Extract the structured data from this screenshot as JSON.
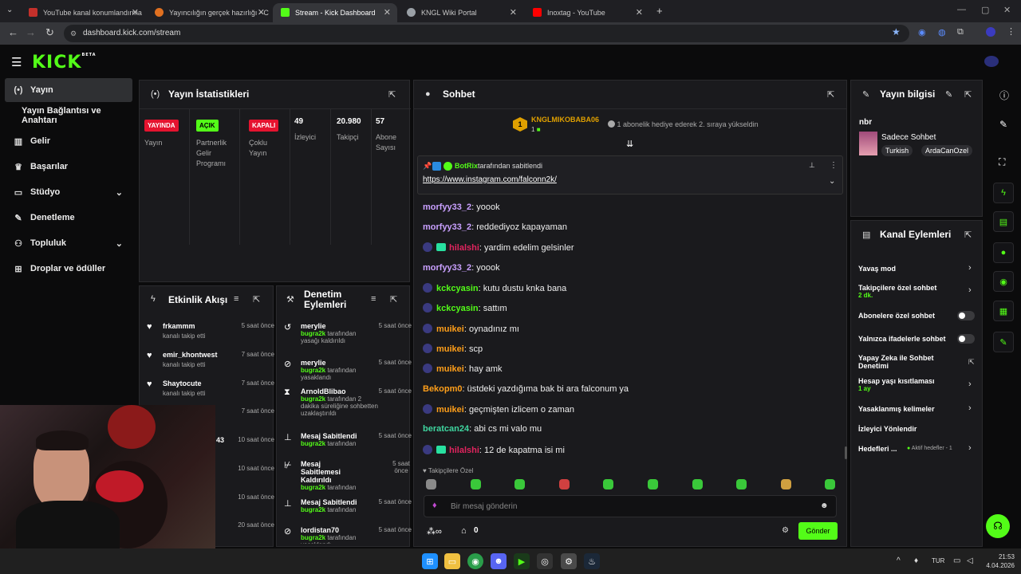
{
  "browser": {
    "tabs": [
      {
        "title": "YouTube kanal konumlandırma",
        "fav": "#c4302b"
      },
      {
        "title": "Yayıncılığın gerçek hazırlığı - C",
        "fav": "#e07020"
      },
      {
        "title": "Stream - Kick Dashboard",
        "fav": "#53fc18"
      },
      {
        "title": "KNGL Wiki Portal",
        "fav": "#9aa0a6"
      },
      {
        "title": "Inoxtag - YouTube",
        "fav": "#ff0000"
      }
    ],
    "url": "dashboard.kick.com/stream"
  },
  "brand": {
    "logo": "KICK",
    "beta": "BETA",
    "accent": "#53fc18"
  },
  "sidebar": {
    "items": [
      {
        "label": "Yayın",
        "icon": "broadcast-icon"
      },
      {
        "label": "Yayın Bağlantısı ve Anahtarı",
        "icon": ""
      },
      {
        "label": "Gelir",
        "icon": "chart-icon"
      },
      {
        "label": "Başarılar",
        "icon": "trophy-icon"
      },
      {
        "label": "Stüdyo",
        "icon": "studio-icon"
      },
      {
        "label": "Denetleme",
        "icon": "wrench-icon"
      },
      {
        "label": "Topluluk",
        "icon": "users-icon"
      },
      {
        "label": "Droplar ve ödüller",
        "icon": "gift-icon"
      }
    ]
  },
  "stats": {
    "title": "Yayın İstatistikleri",
    "cols": [
      {
        "badge": "YAYINDA",
        "label": "Yayın"
      },
      {
        "badge": "AÇIK",
        "label": "Partnerlik Gelir Programı"
      },
      {
        "badge": "KAPALI",
        "label": "Çoklu Yayın"
      },
      {
        "value": "49",
        "label": "İzleyici"
      },
      {
        "value": "20.980",
        "label": "Takipçi"
      },
      {
        "value": "57",
        "label": "Abone Sayısı"
      }
    ]
  },
  "activity": {
    "title": "Etkinlik Akışı",
    "items": [
      {
        "user": "frkammm",
        "text": "kanalı takip etti",
        "time": "5 saat önce"
      },
      {
        "user": "emir_khontwest",
        "text": "kanalı takip etti",
        "time": "7 saat önce"
      },
      {
        "user": "Shaytocute",
        "text": "kanalı takip etti",
        "time": "7 saat önce"
      },
      {
        "user": "a",
        "text": "",
        "time": "7 saat önce"
      },
      {
        "user": "43",
        "text": "",
        "time": "10 saat önce"
      },
      {
        "user": "",
        "text": "",
        "time": "10 saat önce"
      },
      {
        "user": "",
        "text": "",
        "time": "10 saat önce"
      },
      {
        "user": "",
        "text": "",
        "time": "20 saat önce"
      }
    ]
  },
  "moderation": {
    "title": "Denetim Eylemleri",
    "items": [
      {
        "user": "merylie",
        "by": "bugra2k",
        "text": "tarafından yasağı kaldırıldı",
        "time": "5 saat önce",
        "icon": "undo-icon"
      },
      {
        "user": "merylie",
        "by": "bugra2k",
        "text": "tarafından yasaklandı",
        "time": "5 saat önce",
        "icon": "ban-icon"
      },
      {
        "user": "ArnoldBlibao",
        "by": "bugra2k",
        "text": "tarafından 2 dakika süreliğine sohbetten uzaklaştırıldı",
        "time": "5 saat önce",
        "icon": "hourglass-icon"
      },
      {
        "user": "Mesaj Sabitlendi",
        "by": "bugra2k",
        "text": "tarafından",
        "time": "5 saat önce",
        "icon": "pin-icon"
      },
      {
        "user": "Mesaj Sabitlemesi Kaldırıldı",
        "by": "bugra2k",
        "text": "tarafından",
        "time": "5 saat önce",
        "icon": "unpin-icon"
      },
      {
        "user": "Mesaj Sabitlendi",
        "by": "bugra2k",
        "text": "tarafından",
        "time": "5 saat önce",
        "icon": "pin-icon"
      },
      {
        "user": "lordistan70",
        "by": "bugra2k",
        "text": "tarafından yasaklandı",
        "time": "5 saat önce",
        "icon": "ban-icon"
      }
    ]
  },
  "chat": {
    "title": "Sohbet",
    "gift_user": "KNGLMIKOBABA06",
    "gift_count": "1",
    "gift_rank": "1",
    "gift_text": "1 abonelik hediye ederek 2. sıraya yükseldin",
    "pinned_by": "BotRix",
    "pinned_suffix": "tarafından sabitlendi",
    "pinned_link": "https://www.instagram.com/falconn2k/",
    "messages": [
      {
        "user": "morfyy33_2",
        "color": "#c9a0ff",
        "text": ": yoook",
        "av": false,
        "gift": false
      },
      {
        "user": "morfyy33_2",
        "color": "#c9a0ff",
        "text": ": reddediyoz kapayaman",
        "av": false,
        "gift": false
      },
      {
        "user": "hilalshi",
        "color": "#e0245e",
        "text": ": yardim edelim gelsinler",
        "av": true,
        "gift": true
      },
      {
        "user": "morfyy33_2",
        "color": "#c9a0ff",
        "text": ": yoook",
        "av": false,
        "gift": false
      },
      {
        "user": "kckcyasin",
        "color": "#53fc18",
        "text": ": kutu dustu knka bana",
        "av": true,
        "gift": false
      },
      {
        "user": "kckcyasin",
        "color": "#53fc18",
        "text": ": sattım",
        "av": true,
        "gift": false
      },
      {
        "user": "muikei",
        "color": "#ff9f1a",
        "text": ": oynadınız mı",
        "av": true,
        "gift": false
      },
      {
        "user": "muikei",
        "color": "#ff9f1a",
        "text": ": scp",
        "av": true,
        "gift": false
      },
      {
        "user": "muikei",
        "color": "#ff9f1a",
        "text": ": hay amk",
        "av": true,
        "gift": false
      },
      {
        "user": "Bekopm0",
        "color": "#ff9f1a",
        "text": ": üstdeki yazdığıma bak bi ara falconum ya",
        "av": false,
        "gift": false
      },
      {
        "user": "muikei",
        "color": "#ff9f1a",
        "text": ": geçmişten izlicem o zaman",
        "av": true,
        "gift": false
      },
      {
        "user": "beratcan24",
        "color": "#3fd6a0",
        "text": ": abi cs mi valo mu",
        "av": false,
        "gift": false
      },
      {
        "user": "hilalshi",
        "color": "#e0245e",
        "text": ": 12 de kapatma isi mi",
        "av": true,
        "gift": true
      }
    ],
    "follower_only": "Takipçilere Özel",
    "input_placeholder": "Bir mesaj gönderin",
    "points": "0",
    "send": "Gönder"
  },
  "info": {
    "title": "Yayın bilgisi",
    "stream_title": "nbr",
    "category": "Sadece Sohbet",
    "tags": [
      "Turkish",
      "ArdaCanOzel"
    ]
  },
  "channel_actions": {
    "title": "Kanal Eylemleri",
    "items": [
      {
        "label": "Yavaş mod",
        "sub": "",
        "control": "chevron"
      },
      {
        "label": "Takipçilere özel sohbet",
        "sub": "2 dk.",
        "control": "chevron"
      },
      {
        "label": "Abonelere özel sohbet",
        "sub": "",
        "control": "toggle"
      },
      {
        "label": "Yalnızca ifadelerle sohbet",
        "sub": "",
        "control": "toggle"
      },
      {
        "label": "Yapay Zeka ile Sohbet Denetimi",
        "sub": "",
        "control": "external"
      },
      {
        "label": "Hesap yaşı kısıtlaması",
        "sub": "1 ay",
        "control": "chevron"
      },
      {
        "label": "Yasaklanmış kelimeler",
        "sub": "",
        "control": "chevron"
      },
      {
        "label": "İzleyici Yönlendir",
        "sub": "",
        "control": "none"
      },
      {
        "label": "Hedefleri ...",
        "sub": "Aktif hedefler - 1",
        "control": "chevron"
      }
    ]
  },
  "taskbar": {
    "lang": "TUR",
    "time": "21:53",
    "date": "4.04.2026"
  }
}
